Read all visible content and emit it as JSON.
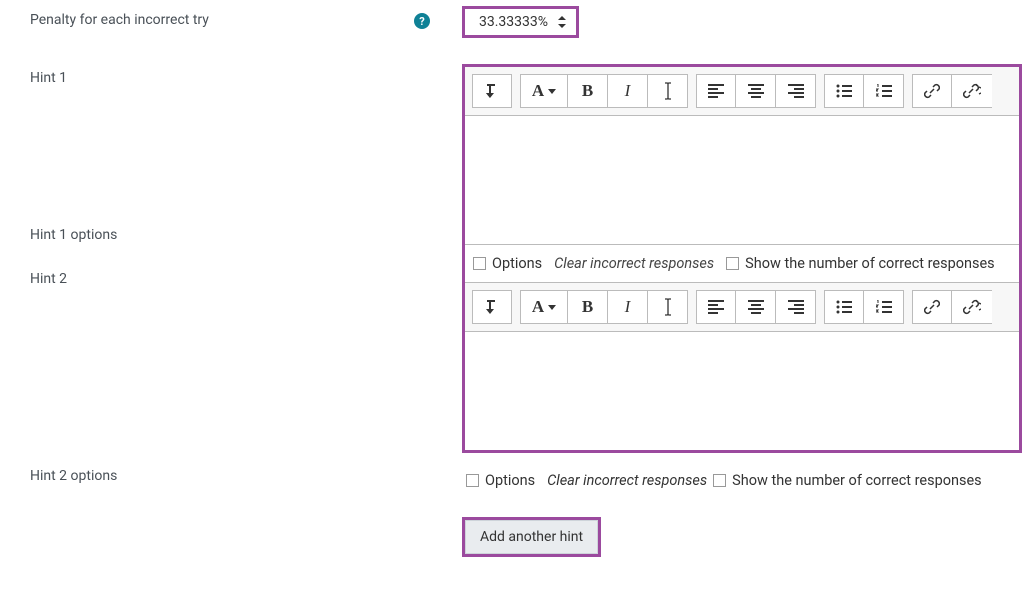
{
  "penalty": {
    "label": "Penalty for each incorrect try",
    "value": "33.33333%"
  },
  "hint1": {
    "label": "Hint 1",
    "options_label": "Hint 1 options",
    "options_checkbox_label": "Options",
    "clear_label": "Clear incorrect responses",
    "show_label": "Show the number of correct responses"
  },
  "hint2": {
    "label": "Hint 2",
    "options_label": "Hint 2 options",
    "options_checkbox_label": "Options",
    "clear_label": "Clear incorrect responses",
    "show_label": "Show the number of correct responses"
  },
  "add_hint_label": "Add another hint",
  "toolbar": {
    "para_letter": "A",
    "bold": "B",
    "italic": "I"
  }
}
